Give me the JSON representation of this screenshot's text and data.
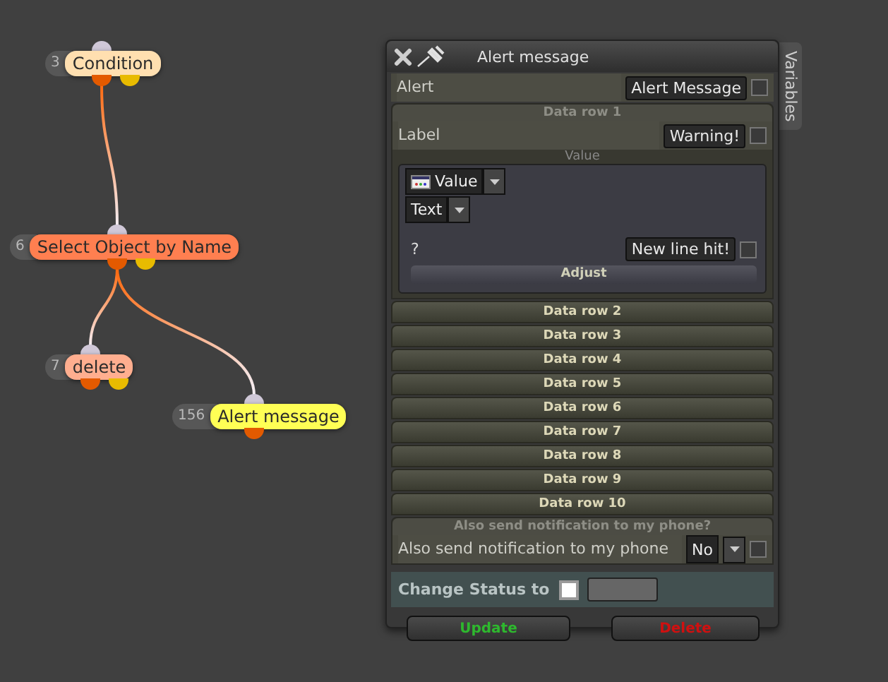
{
  "graph": {
    "nodes": [
      {
        "number": "3",
        "label": "Condition",
        "color": "#ffdfb0",
        "second_output": true,
        "children": [
          {
            "number": "6",
            "label": "Select Object by Name",
            "color": "#ff7f50",
            "second_output": true,
            "children": [
              {
                "number": "7",
                "label": "delete",
                "color": "#ffae8f",
                "second_output": true
              },
              {
                "number": "156",
                "label": "Alert message",
                "color": "#ffff55",
                "second_output": false
              }
            ]
          }
        ]
      }
    ]
  },
  "panel": {
    "title": "Alert message",
    "side_tab": "Variables",
    "alert": {
      "label": "Alert",
      "value": "Alert Message",
      "checked": false
    },
    "data_rows": [
      {
        "title": "Data row 1",
        "expanded": true,
        "label": "Label",
        "label_value": "Warning!",
        "label_checked": false,
        "value_header": "Value",
        "value_type": "Value",
        "value_format": "Text",
        "question": "?",
        "new_line": "New line hit!",
        "new_line_checked": false,
        "adjust": "Adjust"
      },
      {
        "title": "Data row 2",
        "expanded": false
      },
      {
        "title": "Data row 3",
        "expanded": false
      },
      {
        "title": "Data row 4",
        "expanded": false
      },
      {
        "title": "Data row 5",
        "expanded": false
      },
      {
        "title": "Data row 6",
        "expanded": false
      },
      {
        "title": "Data row 7",
        "expanded": false
      },
      {
        "title": "Data row 8",
        "expanded": false
      },
      {
        "title": "Data row 9",
        "expanded": false
      },
      {
        "title": "Data row 10",
        "expanded": false
      }
    ],
    "notify": {
      "header": "Also send notification to my phone?",
      "label": "Also send notification to my phone",
      "value": "No",
      "checked": false
    },
    "status": {
      "label": "Change Status to"
    },
    "buttons": [
      {
        "label": "Update",
        "kind": "update"
      },
      {
        "label": "Delete",
        "kind": "delete"
      }
    ]
  }
}
